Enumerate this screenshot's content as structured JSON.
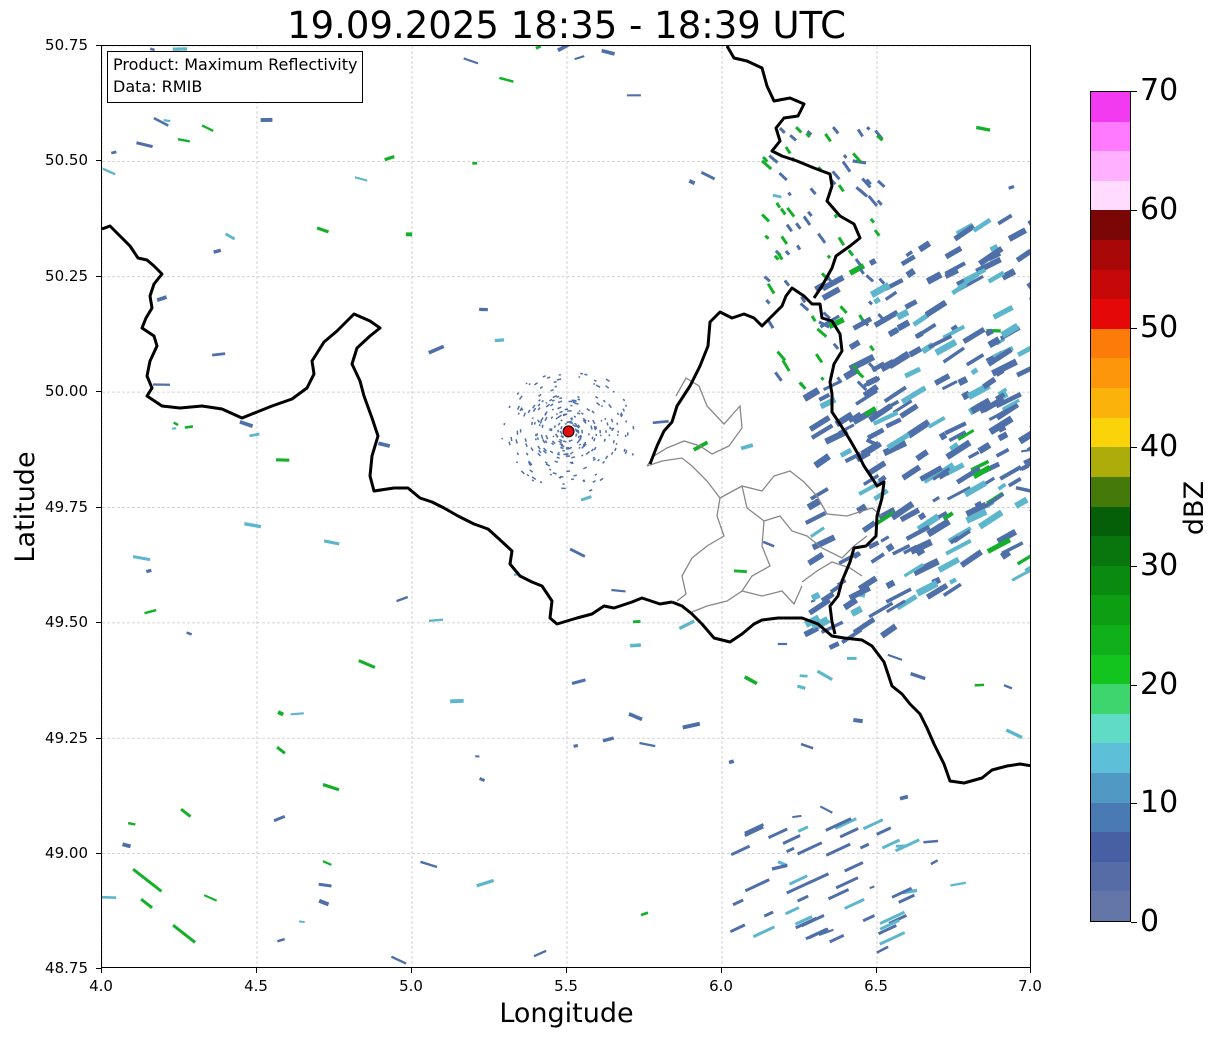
{
  "title": "19.09.2025 18:35 - 18:39 UTC",
  "info": {
    "product": "Product: Maximum Reflectivity",
    "source": "Data: RMIB"
  },
  "axes": {
    "xlabel": "Longitude",
    "ylabel": "Latitude",
    "xlim": [
      4.0,
      7.0
    ],
    "ylim": [
      48.75,
      50.75
    ],
    "xticks": [
      "4.0",
      "4.5",
      "5.0",
      "5.5",
      "6.0",
      "6.5",
      "7.0"
    ],
    "yticks": [
      "50.75",
      "50.50",
      "50.25",
      "50.00",
      "49.75",
      "49.50",
      "49.25",
      "49.00",
      "48.75"
    ],
    "grid": true
  },
  "radar_site": {
    "lon": 5.505,
    "lat": 49.915,
    "color": "#e01010"
  },
  "colorbar": {
    "label": "dBZ",
    "range": [
      0,
      70
    ],
    "tick_labels": [
      "0",
      "10",
      "20",
      "30",
      "40",
      "50",
      "60",
      "70"
    ],
    "colors": [
      "#6476a8",
      "#566ca6",
      "#4760a4",
      "#4a7ab4",
      "#4f99c4",
      "#5ec0d8",
      "#60dcc6",
      "#3dd56d",
      "#14c41e",
      "#10b01a",
      "#0e9e14",
      "#0b8a10",
      "#08760c",
      "#055f08",
      "#457a0a",
      "#acac0a",
      "#fad30a",
      "#fbb20a",
      "#fd960a",
      "#fd7b08",
      "#e40808",
      "#c60808",
      "#a80808",
      "#7a0606",
      "#ffdcff",
      "#ffb0ff",
      "#ff7aff",
      "#f23af0"
    ]
  },
  "echo_colors": {
    "weak": "#4f6fa8",
    "light": "#5eb6cc",
    "moderate": "#14b02a"
  }
}
